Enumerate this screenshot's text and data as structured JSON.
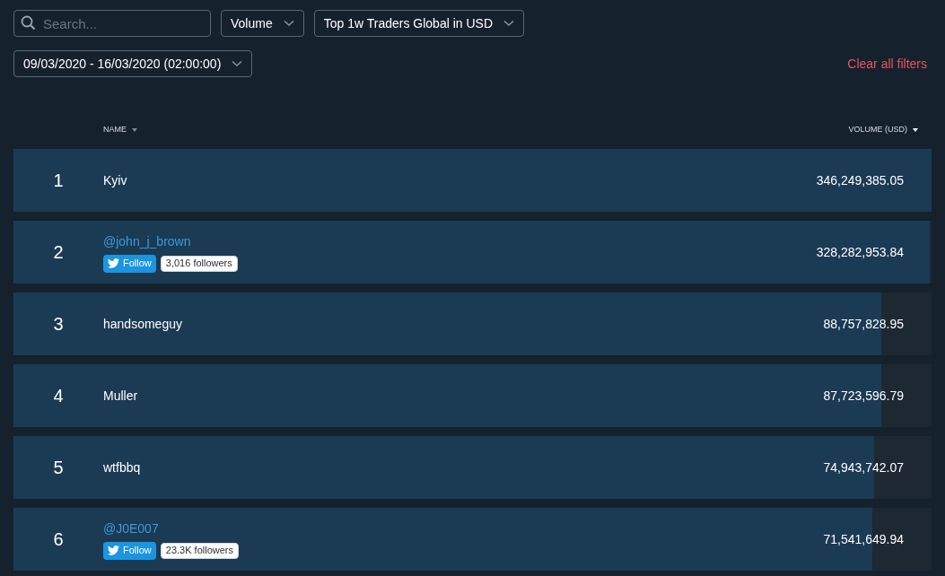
{
  "search": {
    "placeholder": "Search..."
  },
  "filters": [
    {
      "label": "Volume"
    },
    {
      "label": "Top 1w Traders Global in USD"
    }
  ],
  "date_range": {
    "label": "09/03/2020 - 16/03/2020 (02:00:00)"
  },
  "clear_filters": "Clear all filters",
  "table": {
    "columns": [
      {
        "label": "NAME",
        "sorted": false
      },
      {
        "label": "VOLUME (USD)",
        "sorted": true
      }
    ],
    "rows": [
      {
        "rank": "1",
        "kind": "plain",
        "name": "Kyiv",
        "volume": "346,249,385.05",
        "level": 1
      },
      {
        "rank": "2",
        "kind": "twitter",
        "name": "@john_j_brown",
        "follow": "Follow",
        "followers": "3,016 followers",
        "volume": "328,282,953.84",
        "level": 0.998
      },
      {
        "rank": "3",
        "kind": "plain",
        "name": "handsomeguy",
        "volume": "88,757,828.95",
        "level": 0.945
      },
      {
        "rank": "4",
        "kind": "plain",
        "name": "Muller",
        "volume": "87,723,596.79",
        "level": 0.945
      },
      {
        "rank": "5",
        "kind": "plain",
        "name": "wtfbbq",
        "volume": "74,943,742.07",
        "level": 0.937
      },
      {
        "rank": "6",
        "kind": "twitter",
        "name": "@J0E007",
        "follow": "Follow",
        "followers": "23.3K followers",
        "volume": "71,541,649.94",
        "level": 0.935
      }
    ]
  }
}
